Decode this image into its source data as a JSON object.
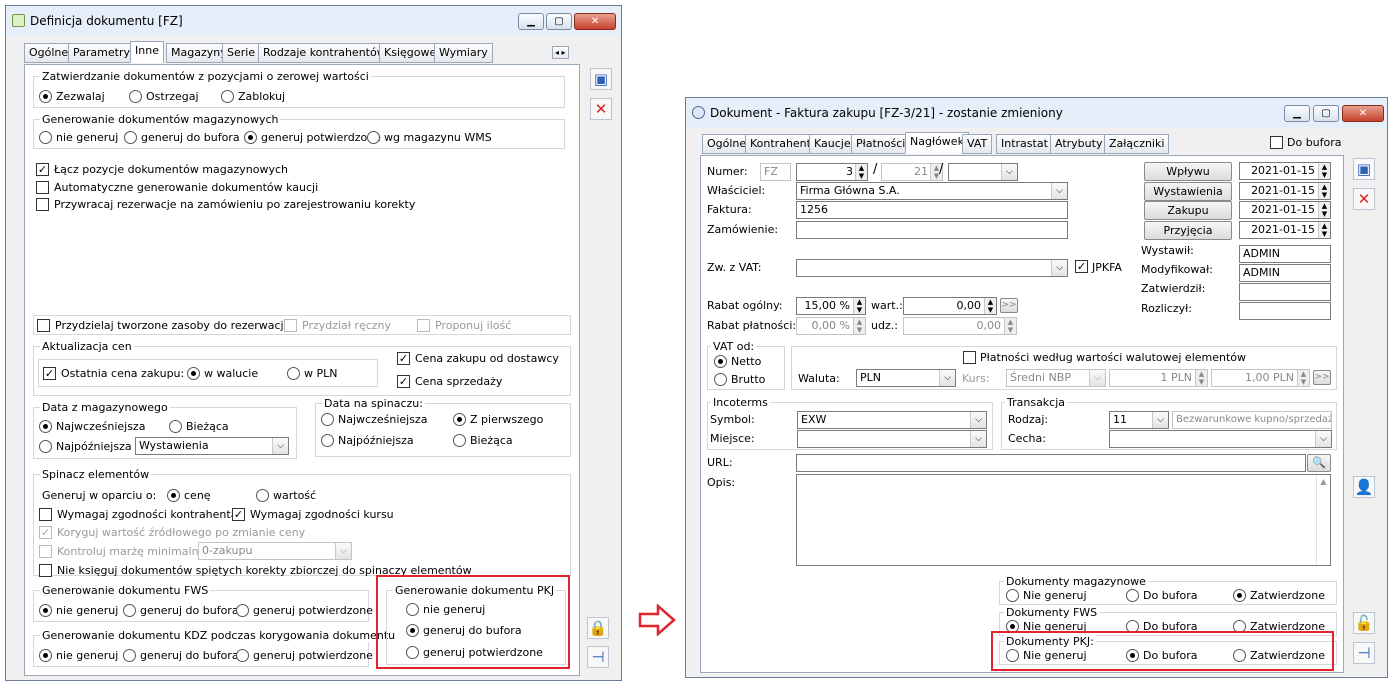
{
  "left": {
    "title": "Definicja dokumentu [FZ]",
    "tabs": [
      "Ogólne",
      "Parametry",
      "Inne",
      "Magazyny",
      "Serie",
      "Rodzaje kontrahentów",
      "Księgowe",
      "Wymiary"
    ],
    "zerowe": {
      "label": "Zatwierdzanie dokumentów z pozycjami o zerowej wartości",
      "opts": [
        "Zezwalaj",
        "Ostrzegaj",
        "Zablokuj"
      ]
    },
    "genmag": {
      "label": "Generowanie dokumentów magazynowych",
      "opts": [
        "nie generuj",
        "generuj do bufora",
        "generuj potwierdzone",
        "wg magazynu WMS"
      ]
    },
    "checks": [
      "Łącz pozycje dokumentów magazynowych",
      "Automatyczne generowanie dokumentów kaucji",
      "Przywracaj rezerwacje na zamówieniu po zarejestrowaniu korekty"
    ],
    "zasoby": [
      "Przydzielaj tworzone zasoby do rezerwacji",
      "Przydział ręczny",
      "Proponuj ilość"
    ],
    "akt": {
      "label": "Aktualizacja cen",
      "ostatnia": "Ostatnia cena zakupu:",
      "w_walucie": "w walucie",
      "w_pln": "w PLN",
      "cena_dost": "Cena zakupu od dostawcy",
      "cena_sprz": "Cena sprzedaży"
    },
    "datamag": {
      "label": "Data z magazynowego",
      "naj": "Najwcześniejsza",
      "biez": "Bieżąca",
      "pozn": "Najpóźniejsza",
      "sel": "Wystawienia"
    },
    "dataspin": {
      "label": "Data na spinaczu:",
      "naj": "Najwcześniejsza",
      "zpierw": "Z pierwszego",
      "pozn": "Najpóźniejsza",
      "biez": "Bieżąca"
    },
    "spinacz": {
      "label": "Spinacz elementów",
      "gen": "Generuj w oparciu o:",
      "cene": "cenę",
      "wartosc": "wartość",
      "zgk": "Wymagaj zgodności kontrahenta",
      "zgkurs": "Wymagaj zgodności kursu",
      "koryguj": "Koryguj wartość źródłowego po zmianie ceny",
      "kontroluj": "Kontroluj marżę minimalną",
      "kontr_sel": "0-zakupu",
      "nieks": "Nie księguj dokumentów spiętych korekty zbiorczej do spinaczy elementów"
    },
    "fws": {
      "label": "Generowanie dokumentu FWS",
      "opts": [
        "nie generuj",
        "generuj do bufora",
        "generuj potwierdzone"
      ]
    },
    "kdz": {
      "label": "Generowanie dokumentu KDZ podczas korygowania dokumentu",
      "opts": [
        "nie generuj",
        "generuj do bufora",
        "generuj potwierdzone"
      ]
    },
    "pkj": {
      "label": "Generowanie dokumentu PKJ",
      "opts": [
        "nie generuj",
        "generuj do bufora",
        "generuj potwierdzone"
      ]
    }
  },
  "right": {
    "title": "Dokument - Faktura zakupu [FZ-3/21]  - zostanie zmieniony",
    "tabs": [
      "Ogólne",
      "Kontrahent",
      "Kaucje",
      "Płatności",
      "Nagłówek",
      "VAT",
      "Intrastat",
      "Atrybuty",
      "Załączniki"
    ],
    "do_bufora": "Do bufora",
    "numer": {
      "label": "Numer:",
      "prefix": "FZ",
      "num": "3",
      "year": "21"
    },
    "wlasciciel": {
      "label": "Właściciel:",
      "value": "Firma Główna S.A."
    },
    "faktura": {
      "label": "Faktura:",
      "value": "1256"
    },
    "zamowienie": {
      "label": "Zamówienie:"
    },
    "dates": [
      {
        "btn": "Wpływu",
        "val": "2021-01-15"
      },
      {
        "btn": "Wystawienia",
        "val": "2021-01-15"
      },
      {
        "btn": "Zakupu",
        "val": "2021-01-15"
      },
      {
        "btn": "Przyjęcia",
        "val": "2021-01-15"
      }
    ],
    "people": [
      {
        "l": "Wystawił:",
        "v": "ADMIN"
      },
      {
        "l": "Modyfikował:",
        "v": "ADMIN"
      },
      {
        "l": "Zatwierdził:",
        "v": ""
      },
      {
        "l": "Rozliczył:",
        "v": ""
      }
    ],
    "zwvat": "Zw. z VAT:",
    "jpkfa": "JPKFA",
    "rabat_og": {
      "l": "Rabat ogólny:",
      "v": "15,00 %",
      "wl": "wart.:",
      "wv": "0,00"
    },
    "rabat_pl": {
      "l": "Rabat płatności:",
      "v": "0,00 %",
      "ul": "udz.:",
      "uv": "0,00"
    },
    "vatod": {
      "label": "VAT od:",
      "netto": "Netto",
      "brutto": "Brutto"
    },
    "platnosci": "Płatności według wartości walutowej elementów",
    "waluta": {
      "l": "Waluta:",
      "v": "PLN",
      "kl": "Kurs:",
      "kv": "Średni NBP",
      "a": "1 PLN",
      "b": "1,00 PLN"
    },
    "incoterms": {
      "label": "Incoterms",
      "sym_l": "Symbol:",
      "sym_v": "EXW",
      "miejsce": "Miejsce:"
    },
    "transakcja": {
      "label": "Transakcja",
      "rodz_l": "Rodzaj:",
      "rodz_v": "11",
      "rodz_d": "Bezwarunkowe kupno/sprzedaż",
      "cecha": "Cecha:"
    },
    "url": "URL:",
    "opis": "Opis:",
    "dmag": {
      "label": "Dokumenty magazynowe",
      "opts": [
        "Nie generuj",
        "Do bufora",
        "Zatwierdzone"
      ]
    },
    "dfws": {
      "label": "Dokumenty FWS",
      "opts": [
        "Nie generuj",
        "Do bufora",
        "Zatwierdzone"
      ]
    },
    "dpkj": {
      "label": "Dokumenty PKJ:",
      "opts": [
        "Nie generuj",
        "Do bufora",
        "Zatwierdzone"
      ]
    }
  },
  "colors": {
    "highlight": "#e0252f",
    "title_bg": "#e6eef9"
  }
}
